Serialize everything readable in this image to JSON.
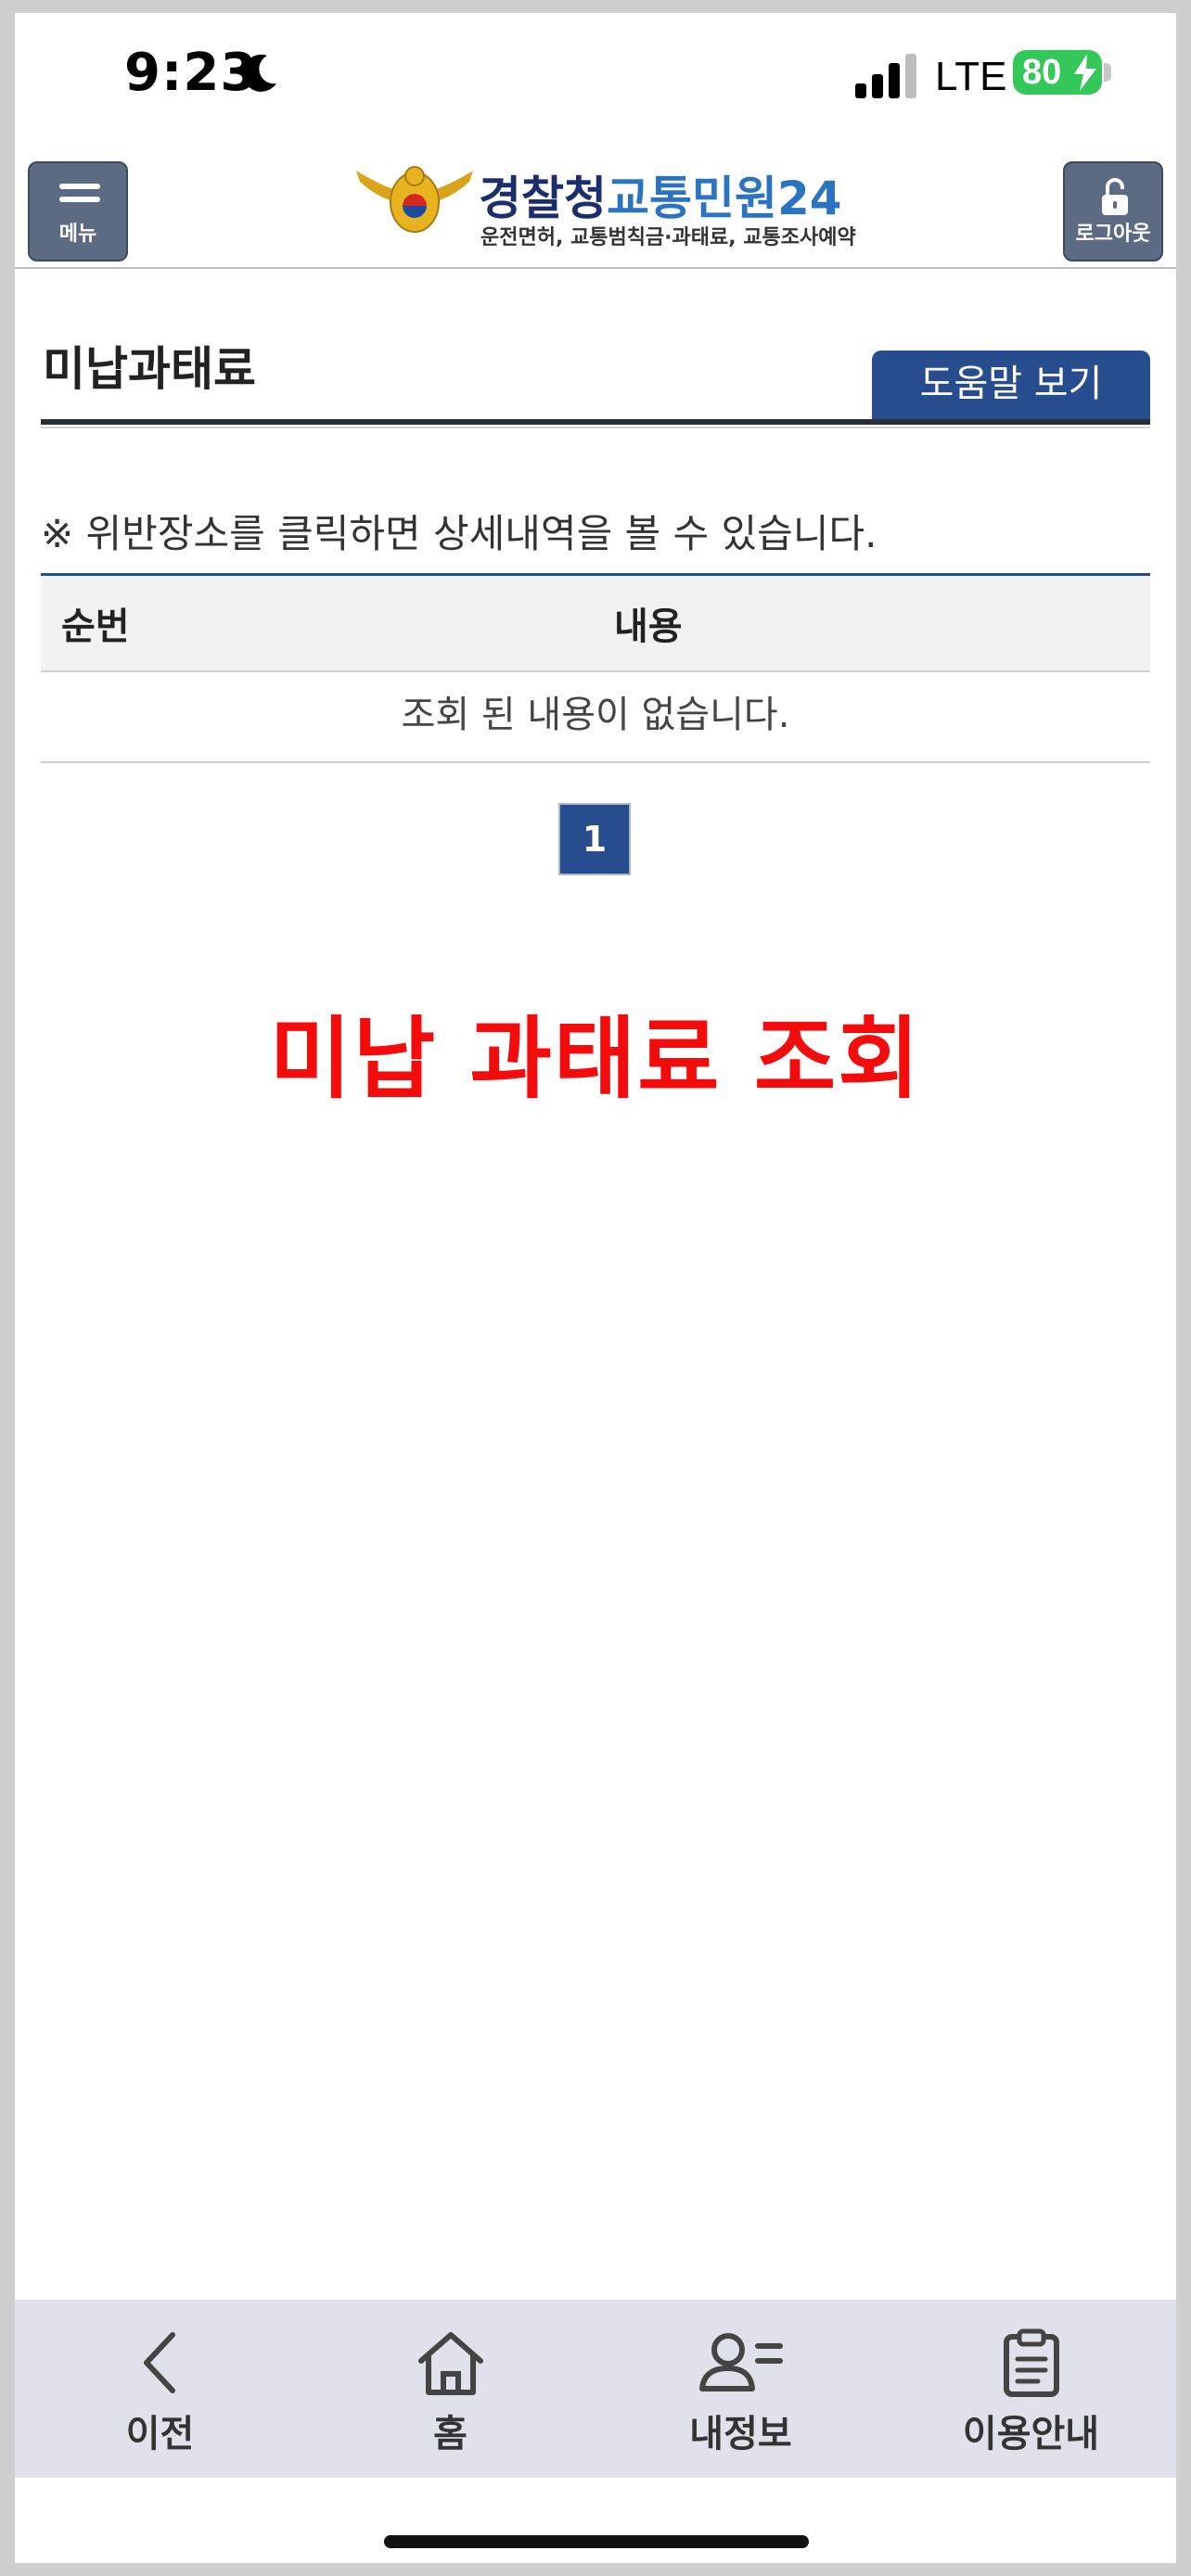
{
  "status_bar": {
    "time": "9:23",
    "network": "LTE",
    "battery": "80"
  },
  "header": {
    "menu_label": "메뉴",
    "logout_label": "로그아웃",
    "logo_title_a": "경찰청",
    "logo_title_b": "교통민원24",
    "logo_subtitle": "운전면허, 교통범칙금·과태료, 교통조사예약"
  },
  "page": {
    "title": "미납과태료",
    "help_button": "도움말 보기",
    "notice": "※ 위반장소를 클릭하면 상세내역을 볼 수 있습니다.",
    "table": {
      "col_no": "순번",
      "col_content": "내용",
      "empty_message": "조회 된 내용이 없습니다."
    },
    "pagination": {
      "current": "1"
    },
    "banner": "미납 과태료 조회"
  },
  "bottom_nav": {
    "items": [
      {
        "label": "이전",
        "icon": "back-chevron-icon"
      },
      {
        "label": "홈",
        "icon": "home-icon"
      },
      {
        "label": "내정보",
        "icon": "user-info-icon"
      },
      {
        "label": "이용안내",
        "icon": "clipboard-icon"
      }
    ]
  },
  "colors": {
    "primary": "#274d8e",
    "banner": "#f40c0c",
    "battery": "#34c759"
  }
}
